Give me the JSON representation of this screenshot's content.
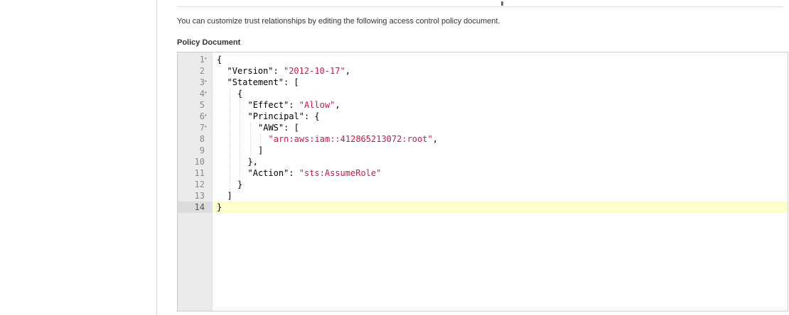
{
  "header": {
    "tick_label": ""
  },
  "main": {
    "description": "You can customize trust relationships by editing the following access control policy document.",
    "section_label": "Policy Document"
  },
  "editor": {
    "fold_glyph": "▾",
    "active_line": 14,
    "colors": {
      "string": "#dd1144",
      "active_line_bg": "#ffffcc",
      "gutter_bg": "#ebebeb"
    },
    "lines": [
      {
        "n": "1",
        "indent": 0,
        "fold": true,
        "tokens": [
          {
            "t": "{",
            "c": "p"
          }
        ]
      },
      {
        "n": "2",
        "indent": 1,
        "fold": false,
        "tokens": [
          {
            "t": "\"Version\": ",
            "c": "k"
          },
          {
            "t": "\"2012-10-17\"",
            "c": "s"
          },
          {
            "t": ",",
            "c": "p"
          }
        ]
      },
      {
        "n": "3",
        "indent": 1,
        "fold": true,
        "tokens": [
          {
            "t": "\"Statement\": [",
            "c": "k"
          }
        ]
      },
      {
        "n": "4",
        "indent": 2,
        "fold": true,
        "tokens": [
          {
            "t": "{",
            "c": "p"
          }
        ]
      },
      {
        "n": "5",
        "indent": 3,
        "fold": false,
        "tokens": [
          {
            "t": "\"Effect\": ",
            "c": "k"
          },
          {
            "t": "\"Allow\"",
            "c": "s"
          },
          {
            "t": ",",
            "c": "p"
          }
        ]
      },
      {
        "n": "6",
        "indent": 3,
        "fold": true,
        "tokens": [
          {
            "t": "\"Principal\": {",
            "c": "k"
          }
        ]
      },
      {
        "n": "7",
        "indent": 4,
        "fold": true,
        "tokens": [
          {
            "t": "\"AWS\": [",
            "c": "k"
          }
        ]
      },
      {
        "n": "8",
        "indent": 5,
        "fold": false,
        "tokens": [
          {
            "t": "\"arn:aws:iam::412865213072:root\"",
            "c": "s"
          },
          {
            "t": ",",
            "c": "p"
          }
        ]
      },
      {
        "n": "9",
        "indent": 4,
        "fold": false,
        "tokens": [
          {
            "t": "]",
            "c": "p"
          }
        ]
      },
      {
        "n": "10",
        "indent": 3,
        "fold": false,
        "tokens": [
          {
            "t": "},",
            "c": "p"
          }
        ]
      },
      {
        "n": "11",
        "indent": 3,
        "fold": false,
        "tokens": [
          {
            "t": "\"Action\": ",
            "c": "k"
          },
          {
            "t": "\"sts:AssumeRole\"",
            "c": "s"
          }
        ]
      },
      {
        "n": "12",
        "indent": 2,
        "fold": false,
        "tokens": [
          {
            "t": "}",
            "c": "p"
          }
        ]
      },
      {
        "n": "13",
        "indent": 1,
        "fold": false,
        "tokens": [
          {
            "t": "]",
            "c": "p"
          }
        ]
      },
      {
        "n": "14",
        "indent": 0,
        "fold": false,
        "tokens": [
          {
            "t": "}",
            "c": "p"
          }
        ]
      }
    ]
  }
}
